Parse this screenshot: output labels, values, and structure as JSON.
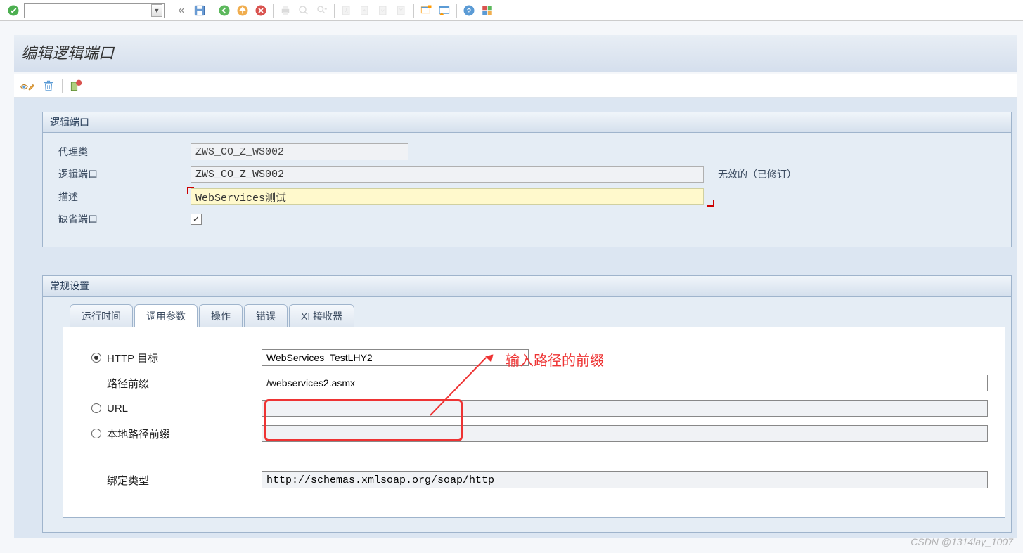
{
  "toolbar": {
    "dropdown_value": "",
    "icons": [
      "check",
      "dropdown",
      "back",
      "save",
      "sep",
      "exec-green",
      "exec-orange",
      "exec-red",
      "sep",
      "print",
      "find",
      "find-next",
      "sep",
      "page-first",
      "page-prev",
      "page-next",
      "page-last",
      "sep",
      "new-session",
      "layout",
      "sep",
      "help",
      "palette"
    ]
  },
  "page": {
    "title": "编辑逻辑端口"
  },
  "subtoolbar": {
    "icons": [
      "glasses-edit",
      "trash",
      "sep",
      "lock-variant"
    ]
  },
  "group1": {
    "title": "逻辑端口",
    "rows": {
      "proxy_class_label": "代理类",
      "proxy_class_value": "ZWS_CO_Z_WS002",
      "logical_port_label": "逻辑端口",
      "logical_port_value": "ZWS_CO_Z_WS002",
      "logical_port_status": "无效的（已修订）",
      "desc_label": "描述",
      "desc_value": "WebServices测试",
      "default_port_label": "缺省端口",
      "default_port_checked": true
    }
  },
  "group2": {
    "title": "常规设置",
    "tabs": [
      "运行时间",
      "调用参数",
      "操作",
      "错误",
      "XI 接收器"
    ],
    "active_tab": 1,
    "call_params": {
      "http_target_label": "HTTP 目标",
      "http_target_value": "WebServices_TestLHY2",
      "path_prefix_label": "路径前缀",
      "path_prefix_value": "/webservices2.asmx",
      "url_label": "URL",
      "url_value": "",
      "local_path_label": "本地路径前缀",
      "local_path_value": "",
      "binding_type_label": "绑定类型",
      "binding_type_value": "http://schemas.xmlsoap.org/soap/http"
    }
  },
  "annotation": {
    "text": "输入路径的前缀"
  },
  "watermark": "CSDN @1314lay_1007"
}
